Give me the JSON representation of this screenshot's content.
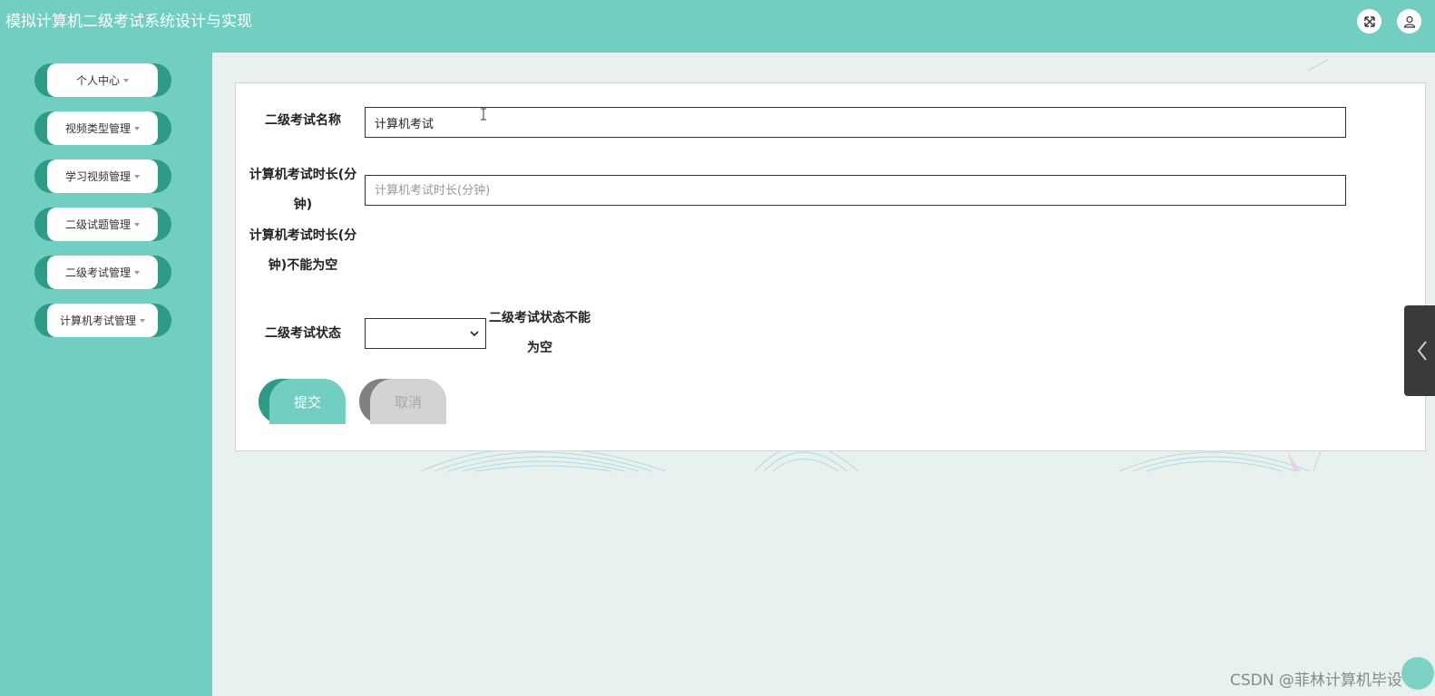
{
  "header": {
    "app_title": "模拟计算机二级考试系统设计与实现",
    "fullscreen_icon": "expand-icon",
    "user_icon": "user-icon"
  },
  "sidebar": {
    "items": [
      {
        "label": "个人中心"
      },
      {
        "label": "视频类型管理"
      },
      {
        "label": "学习视频管理"
      },
      {
        "label": "二级试题管理"
      },
      {
        "label": "二级考试管理"
      },
      {
        "label": "计算机考试管理"
      }
    ]
  },
  "form": {
    "name_label": "二级考试名称",
    "name_value": "计算机考试",
    "duration_label_line1": "计算机考试时长(分",
    "duration_label_line2": "钟)",
    "duration_placeholder": "计算机考试时长(分钟)",
    "duration_error_line1": "计算机考试时长(分",
    "duration_error_line2": "钟)不能为空",
    "status_label": "二级考试状态",
    "status_selected": "",
    "status_error_line1": "二级考试状态不能",
    "status_error_line2": "为空",
    "submit_label": "提交",
    "cancel_label": "取消"
  },
  "watermark": "CSDN @菲林计算机毕设",
  "colors": {
    "primary": "#71cec0",
    "primary_dark": "#2e9b86",
    "background": "#e8f1ee",
    "cancel_face": "#d3d3d3",
    "cancel_dark": "#808080"
  }
}
